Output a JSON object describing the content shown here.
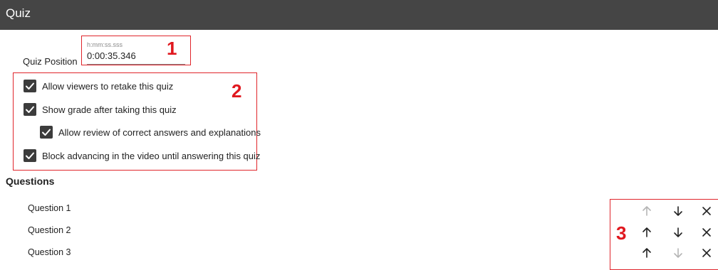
{
  "header": {
    "title": "Quiz"
  },
  "quiz_position": {
    "label": "Quiz Position",
    "placeholder": "h:mm:ss.sss",
    "value": "0:00:35.346"
  },
  "options": [
    {
      "label": "Allow viewers to retake this quiz",
      "checked": true
    },
    {
      "label": "Show grade after taking this quiz",
      "checked": true
    },
    {
      "label": "Allow review of correct answers and explanations",
      "checked": true
    },
    {
      "label": "Block advancing in the video until answering this quiz",
      "checked": true
    }
  ],
  "questions": {
    "title": "Questions",
    "items": [
      {
        "label": "Question 1",
        "up_enabled": false,
        "down_enabled": true
      },
      {
        "label": "Question 2",
        "up_enabled": true,
        "down_enabled": true
      },
      {
        "label": "Question 3",
        "up_enabled": true,
        "down_enabled": false
      }
    ]
  },
  "callouts": {
    "c1": "1",
    "c2": "2",
    "c3": "3"
  },
  "icons": {
    "checkbox": "checkmark-icon",
    "move_up": "arrow-up-icon",
    "move_down": "arrow-down-icon",
    "delete": "close-icon"
  },
  "colors": {
    "header_bg": "#454545",
    "annotation_red": "#e0252b",
    "checkbox_bg": "#3c3c3c",
    "disabled_icon": "#b5b5b5"
  }
}
